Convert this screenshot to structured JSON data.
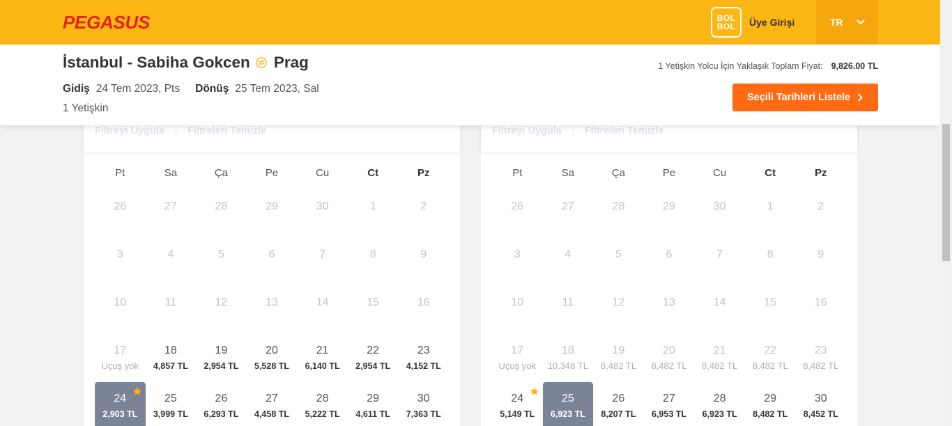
{
  "colors": {
    "brand_yellow": "#fdb714",
    "language_block": "#f5a80e",
    "logo_red": "#e1251b",
    "action_orange": "#ff6a13",
    "selected_day": "#7b8496",
    "star": "#fbb415"
  },
  "icons": {
    "route": "round-trip-icon",
    "language": "chevron-down-icon",
    "list_button": "chevron-right-icon",
    "cheapest_day": "star-icon"
  },
  "header": {
    "logo": "PEGASUS",
    "bolbol_logo": [
      "BOL",
      "BOL"
    ],
    "login": "Üye Girişi",
    "language": "TR"
  },
  "trip": {
    "origin": "İstanbul - Sabiha Gokcen",
    "destination": "Prag",
    "departure_label": "Gidiş",
    "departure_date": "24 Tem 2023, Pts",
    "return_label": "Dönüş",
    "return_date": "25 Tem 2023, Sal",
    "passengers": "1 Yetişkin"
  },
  "summary": {
    "price_label": "1 Yetişkin Yolcu İçin Yaklaşık Toplam Fiyat:",
    "price_value": "9,826.00 TL",
    "list_button": "Seçili Tarihleri Listele"
  },
  "weekdays": [
    "Pt",
    "Sa",
    "Ça",
    "Pe",
    "Cu",
    "Ct",
    "Pz"
  ],
  "calendars": [
    {
      "filter_apply": "Filtreyi Uygula",
      "filter_clear": "Filtreleri Temizle",
      "weeks": [
        [
          {
            "day": 26,
            "disabled": true
          },
          {
            "day": 27,
            "disabled": true
          },
          {
            "day": 28,
            "disabled": true
          },
          {
            "day": 29,
            "disabled": true
          },
          {
            "day": 30,
            "disabled": true
          },
          {
            "day": 1,
            "disabled": true
          },
          {
            "day": 2,
            "disabled": true
          }
        ],
        [
          {
            "day": 3,
            "disabled": true
          },
          {
            "day": 4,
            "disabled": true
          },
          {
            "day": 5,
            "disabled": true
          },
          {
            "day": 6,
            "disabled": true
          },
          {
            "day": 7,
            "disabled": true
          },
          {
            "day": 8,
            "disabled": true
          },
          {
            "day": 9,
            "disabled": true
          }
        ],
        [
          {
            "day": 10,
            "disabled": true
          },
          {
            "day": 11,
            "disabled": true
          },
          {
            "day": 12,
            "disabled": true
          },
          {
            "day": 13,
            "disabled": true
          },
          {
            "day": 14,
            "disabled": true
          },
          {
            "day": 15,
            "disabled": true
          },
          {
            "day": 16,
            "disabled": true
          }
        ],
        [
          {
            "day": 17,
            "price": "Uçuş yok",
            "disabled": true
          },
          {
            "day": 18,
            "price": "4,857 TL"
          },
          {
            "day": 19,
            "price": "2,954 TL"
          },
          {
            "day": 20,
            "price": "5,528 TL"
          },
          {
            "day": 21,
            "price": "6,140 TL"
          },
          {
            "day": 22,
            "price": "2,954 TL"
          },
          {
            "day": 23,
            "price": "4,152 TL"
          }
        ],
        [
          {
            "day": 24,
            "price": "2,903 TL",
            "selected": true,
            "cheapest": true
          },
          {
            "day": 25,
            "price": "3,999 TL"
          },
          {
            "day": 26,
            "price": "6,293 TL"
          },
          {
            "day": 27,
            "price": "4,458 TL"
          },
          {
            "day": 28,
            "price": "5,222 TL"
          },
          {
            "day": 29,
            "price": "4,611 TL"
          },
          {
            "day": 30,
            "price": "7,363 TL"
          }
        ]
      ]
    },
    {
      "filter_apply": "Filtreyi Uygula",
      "filter_clear": "Filtreleri Temizle",
      "weeks": [
        [
          {
            "day": 26,
            "disabled": true
          },
          {
            "day": 27,
            "disabled": true
          },
          {
            "day": 28,
            "disabled": true
          },
          {
            "day": 29,
            "disabled": true
          },
          {
            "day": 30,
            "disabled": true
          },
          {
            "day": 1,
            "disabled": true
          },
          {
            "day": 2,
            "disabled": true
          }
        ],
        [
          {
            "day": 3,
            "disabled": true
          },
          {
            "day": 4,
            "disabled": true
          },
          {
            "day": 5,
            "disabled": true
          },
          {
            "day": 6,
            "disabled": true
          },
          {
            "day": 7,
            "disabled": true
          },
          {
            "day": 8,
            "disabled": true
          },
          {
            "day": 9,
            "disabled": true
          }
        ],
        [
          {
            "day": 10,
            "disabled": true
          },
          {
            "day": 11,
            "disabled": true
          },
          {
            "day": 12,
            "disabled": true
          },
          {
            "day": 13,
            "disabled": true
          },
          {
            "day": 14,
            "disabled": true
          },
          {
            "day": 15,
            "disabled": true
          },
          {
            "day": 16,
            "disabled": true
          }
        ],
        [
          {
            "day": 17,
            "price": "Uçuş yok",
            "disabled": true
          },
          {
            "day": 18,
            "price": "10,348 TL",
            "disabled": true
          },
          {
            "day": 19,
            "price": "8,482 TL",
            "disabled": true
          },
          {
            "day": 20,
            "price": "8,482 TL",
            "disabled": true
          },
          {
            "day": 21,
            "price": "8,482 TL",
            "disabled": true
          },
          {
            "day": 22,
            "price": "8,482 TL",
            "disabled": true
          },
          {
            "day": 23,
            "price": "8,482 TL",
            "disabled": true
          }
        ],
        [
          {
            "day": 24,
            "price": "5,149 TL",
            "cheapest": true
          },
          {
            "day": 25,
            "price": "6,923 TL",
            "selected": true
          },
          {
            "day": 26,
            "price": "8,207 TL"
          },
          {
            "day": 27,
            "price": "6,953 TL"
          },
          {
            "day": 28,
            "price": "6,923 TL"
          },
          {
            "day": 29,
            "price": "8,482 TL"
          },
          {
            "day": 30,
            "price": "8,452 TL"
          }
        ]
      ]
    }
  ]
}
